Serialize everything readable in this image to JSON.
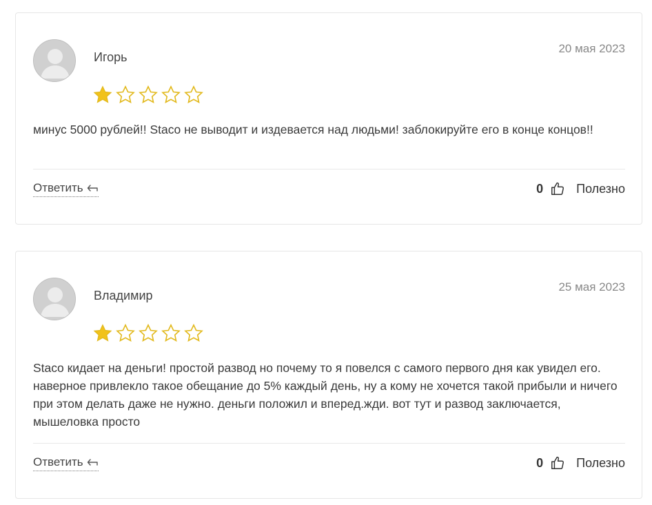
{
  "colors": {
    "star_filled": "#f1c21b",
    "star_outline": "#e2b91c",
    "border": "#e6e6e6",
    "date": "#888888"
  },
  "reviews": [
    {
      "author": "Игорь",
      "date": "20 мая 2023",
      "rating": 1,
      "max_rating": 5,
      "text": "минус 5000 рублей!! Staco не выводит и издевается над людьми! заблокируйте его в конце концов!!",
      "reply_label": "Ответить",
      "likes": "0",
      "helpful_label": "Полезно"
    },
    {
      "author": "Владимир",
      "date": "25 мая 2023",
      "rating": 1,
      "max_rating": 5,
      "text": "Staco кидает на деньги! простой развод но почему то я повелся с самого первого дня как увидел его. наверное привлекло такое обещание до 5% каждый день, ну а кому не хочется такой прибыли и ничего при этом делать даже не нужно. деньги положил и вперед.жди. вот тут и развод заключается, мышеловка просто",
      "reply_label": "Ответить",
      "likes": "0",
      "helpful_label": "Полезно"
    }
  ]
}
